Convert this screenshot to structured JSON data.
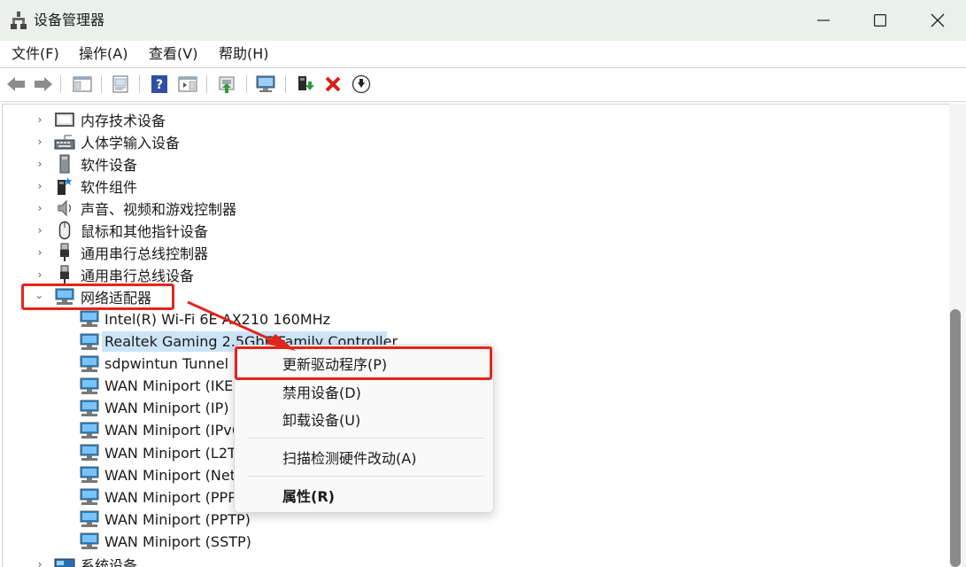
{
  "window": {
    "title": "设备管理器",
    "controls": {
      "minimize": "—",
      "maximize": "☐",
      "close": "✕"
    }
  },
  "menu": [
    "文件(F)",
    "操作(A)",
    "查看(V)",
    "帮助(H)"
  ],
  "toolbar": {
    "icons": [
      "back-icon",
      "forward-icon",
      "show-hide-tree-icon",
      "properties-icon",
      "help-icon",
      "action-pane-icon",
      "update-driver-icon",
      "scan-hardware-icon",
      "add-driver-icon",
      "uninstall-icon",
      "disable-icon"
    ]
  },
  "tree": {
    "categories_before": [
      {
        "label": "内存技术设备",
        "icon": "memory-icon"
      },
      {
        "label": "人体学输入设备",
        "icon": "keyboard-icon"
      },
      {
        "label": "软件设备",
        "icon": "software-device-icon"
      },
      {
        "label": "软件组件",
        "icon": "software-component-icon"
      },
      {
        "label": "声音、视频和游戏控制器",
        "icon": "speaker-icon"
      },
      {
        "label": "鼠标和其他指针设备",
        "icon": "mouse-icon"
      },
      {
        "label": "通用串行总线控制器",
        "icon": "usb-icon"
      },
      {
        "label": "通用串行总线设备",
        "icon": "usb-icon"
      }
    ],
    "expanded_category": {
      "label": "网络适配器",
      "icon": "network-adapter-icon"
    },
    "devices": [
      "Intel(R) Wi-Fi 6E AX210 160MHz",
      "Realtek Gaming 2.5GbE Family Controller",
      "sdpwintun Tunnel",
      "WAN Miniport (IKEv",
      "WAN Miniport (IP)",
      "WAN Miniport (IPv6",
      "WAN Miniport (L2T",
      "WAN Miniport (Net",
      "WAN Miniport (PPP",
      "WAN Miniport (PPTP)",
      "WAN Miniport (SSTP)"
    ],
    "selected_device_index": 1,
    "category_after": {
      "label": "系统设备",
      "icon": "system-device-icon"
    }
  },
  "context_menu": {
    "update_driver": "更新驱动程序(P)",
    "disable": "禁用设备(D)",
    "uninstall": "卸载设备(U)",
    "scan": "扫描检测硬件改动(A)",
    "properties": "属性(R)"
  },
  "colors": {
    "titlebar": "#eaf1ea",
    "selection": "#cce4f7",
    "highlight_red": "#e3241b",
    "uninstall_red": "#d91e18"
  }
}
